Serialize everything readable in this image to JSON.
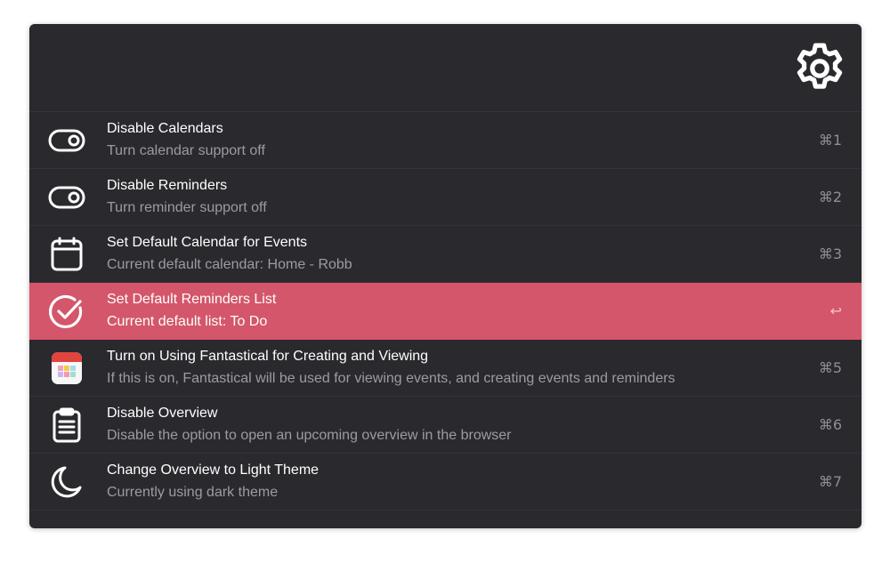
{
  "header": {
    "settings_icon": "gear-icon"
  },
  "items": [
    {
      "icon": "toggle-icon",
      "title": "Disable Calendars",
      "subtitle": "Turn calendar support off",
      "shortcut": "⌘1",
      "selected": false
    },
    {
      "icon": "toggle-icon",
      "title": "Disable Reminders",
      "subtitle": "Turn reminder support off",
      "shortcut": "⌘2",
      "selected": false
    },
    {
      "icon": "calendar-icon",
      "title": "Set Default Calendar for Events",
      "subtitle": "Current default calendar: Home - Robb",
      "shortcut": "⌘3",
      "selected": false
    },
    {
      "icon": "check-circle-icon",
      "title": "Set Default Reminders List",
      "subtitle": "Current default list: To Do",
      "shortcut": "↩",
      "selected": true
    },
    {
      "icon": "fantastical-app-icon",
      "title": "Turn on Using Fantastical for Creating and Viewing",
      "subtitle": "If this is on, Fantastical will be used for viewing events, and creating events and reminders",
      "shortcut": "⌘5",
      "selected": false
    },
    {
      "icon": "clipboard-icon",
      "title": "Disable Overview",
      "subtitle": "Disable the option to open an upcoming overview in the browser",
      "shortcut": "⌘6",
      "selected": false
    },
    {
      "icon": "moon-icon",
      "title": "Change Overview to Light Theme",
      "subtitle": "Currently using dark theme",
      "shortcut": "⌘7",
      "selected": false
    }
  ],
  "colors": {
    "panel_background": "#2a292e",
    "selected_background": "#d4566a",
    "title_text": "#ffffff",
    "subtitle_text": "#9c9ba4",
    "shortcut_text": "#8f8e97"
  }
}
